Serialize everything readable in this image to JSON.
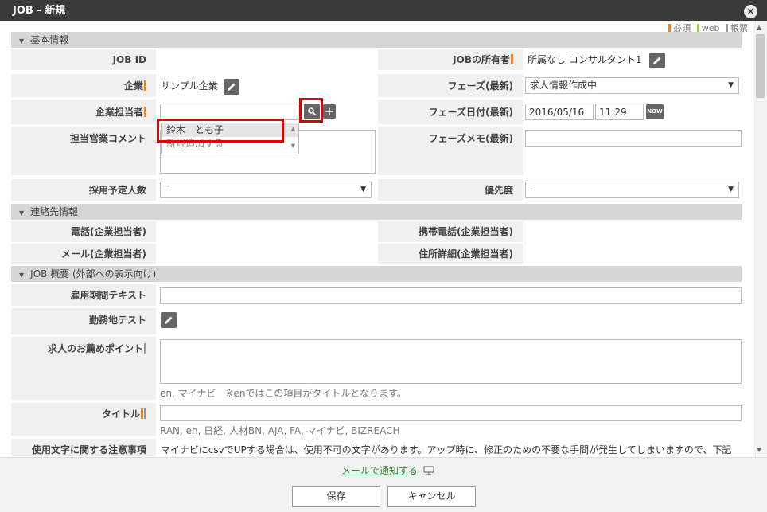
{
  "window": {
    "title": "JOB - 新規",
    "close": "×"
  },
  "legend": [
    {
      "label": "必須",
      "color": "#f08020"
    },
    {
      "label": "web",
      "color": "#9acd32"
    },
    {
      "label": "帳票",
      "color": "#999999"
    }
  ],
  "sections": {
    "basic": "基本情報",
    "contact": "連絡先情報",
    "summary": "JOB 概要 (外部への表示向け)"
  },
  "basic": {
    "job_id_label": "JOB ID",
    "owner_label": "JOBの所有者",
    "owner_value": "所属なし コンサルタント1",
    "company_label": "企業",
    "company_value": "サンプル企業",
    "phase_label": "フェーズ(最新)",
    "phase_value": "求人情報作成中",
    "company_person_label": "企業担当者",
    "company_person_value": "",
    "phase_date_label": "フェーズ日付(最新)",
    "phase_date": "2016/05/16",
    "phase_time": "11:29",
    "now_label": "NOW",
    "sales_comment_label": "担当営業コメント",
    "phase_memo_label": "フェーズメモ(最新)",
    "hire_count_label": "採用予定人数",
    "hire_count_value": "-",
    "priority_label": "優先度",
    "priority_value": "-"
  },
  "autocomplete": {
    "items": [
      "鈴木　とも子",
      "新規追加する"
    ]
  },
  "contact": {
    "phone_label": "電話(企業担当者)",
    "mobile_label": "携帯電話(企業担当者)",
    "mail_label": "メール(企業担当者)",
    "address_label": "住所詳細(企業担当者)"
  },
  "summary": {
    "period_label": "雇用期間テキスト",
    "location_label": "勤務地テスト",
    "points_label": "求人のお薦めポイント",
    "points_hint": "en, マイナビ　※enではこの項目がタイトルとなります。",
    "title_label": "タイトル",
    "title_hint": "RAN, en, 日経, 人材BN, AJA, FA, マイナビ, BIZREACH",
    "notice_label": "使用文字に関する注意事項",
    "notice_text": "マイナビにcsvでUPする場合は、使用不可の文字があります。アップ時に、修正のための不要な手間が発生してしまいますので、下記"
  },
  "footer": {
    "notify": "メールで通知する",
    "save": "保存",
    "cancel": "キャンセル"
  }
}
